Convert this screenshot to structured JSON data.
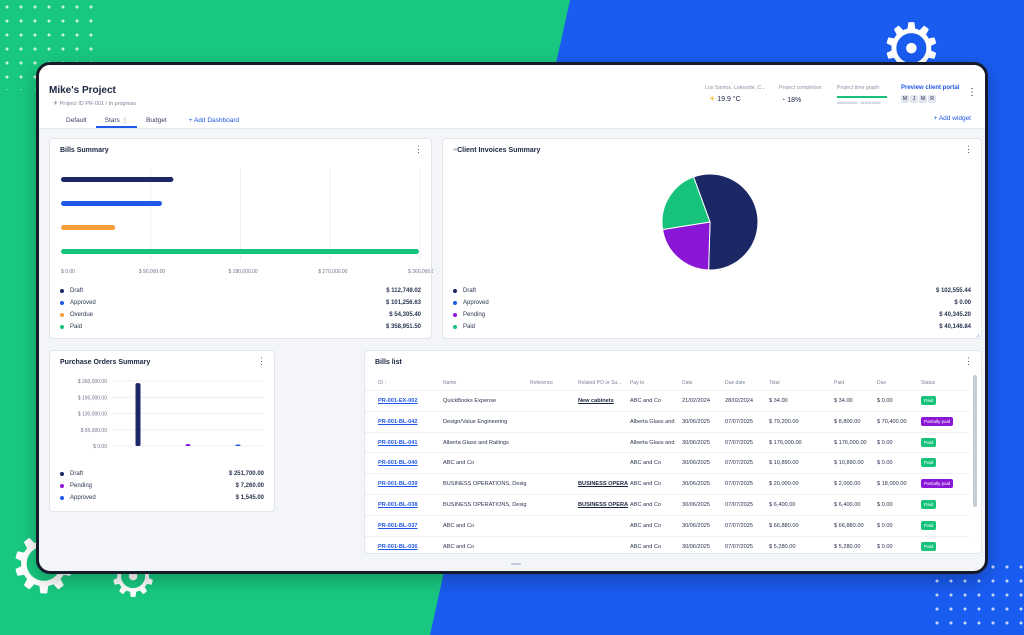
{
  "colors": {
    "navy": "#1c2866",
    "blue": "#1f57e6",
    "orange": "#f59e3a",
    "green": "#17c37b",
    "purple": "#8a17d6",
    "paid": "#17c37b",
    "partial": "#8a17d6"
  },
  "header": {
    "title": "Mike's Project",
    "subtitle": "Project ID PR-001 / In progress",
    "weather_label": "Los Santos, Lakeside, C...",
    "weather_value": "19.9 °C",
    "completion_label": "Project completion",
    "completion_value": "18%",
    "completion_fraction": 0.18,
    "timegraph_label": "Project time graph",
    "timegraph_range": "08/02/2024 - 01/04/2024",
    "preview_label": "Preview client portal",
    "avatars": [
      "M",
      "J",
      "M",
      "R"
    ],
    "tabs": [
      {
        "label": "Default"
      },
      {
        "label": "Stars"
      },
      {
        "label": "Budget"
      }
    ],
    "add_dashboard": "Add Dashboard",
    "add_widget": "Add widget"
  },
  "bills_summary": {
    "title": "Bills Summary",
    "chart_data": {
      "type": "bar",
      "orientation": "horizontal",
      "categories": [
        "Draft",
        "Approved",
        "Overdue",
        "Paid"
      ],
      "values": [
        112749.02,
        101256.63,
        54305.4,
        358951.5
      ],
      "xlim": [
        0,
        360000
      ],
      "xticks": [
        "$ 0.00",
        "$ 90,000.00",
        "$ 180,000.00",
        "$ 270,000.00",
        "$ 360,000.00"
      ]
    },
    "legend": [
      {
        "label": "Draft",
        "value": "$ 112,749.02"
      },
      {
        "label": "Approved",
        "value": "$ 101,256.63"
      },
      {
        "label": "Overdue",
        "value": "$ 54,305.40"
      },
      {
        "label": "Paid",
        "value": "$ 358,951.50"
      }
    ]
  },
  "client_invoices": {
    "title": "Client Invoices Summary",
    "chart_data": {
      "type": "pie",
      "categories": [
        "Draft",
        "Approved",
        "Pending",
        "Paid"
      ],
      "values": [
        102555.44,
        0,
        40345.2,
        40146.84
      ]
    },
    "legend": [
      {
        "label": "Draft",
        "value": "$ 102,555.44"
      },
      {
        "label": "Approved",
        "value": "$ 0.00"
      },
      {
        "label": "Pending",
        "value": "$ 40,345.20"
      },
      {
        "label": "Paid",
        "value": "$ 40,146.84"
      }
    ]
  },
  "purchase_orders": {
    "title": "Purchase Orders Summary",
    "chart_data": {
      "type": "bar",
      "categories": [
        "Draft",
        "Pending",
        "Approved"
      ],
      "values": [
        251700.0,
        7260.0,
        1545.0
      ],
      "ylim": [
        0,
        260000
      ],
      "yticks": [
        "$ 260,000.00",
        "$ 195,000.00",
        "$ 130,000.00",
        "$ 65,000.00",
        "$ 0.00"
      ]
    },
    "legend": [
      {
        "label": "Draft",
        "value": "$ 251,700.00"
      },
      {
        "label": "Pending",
        "value": "$ 7,260.00"
      },
      {
        "label": "Approved",
        "value": "$ 1,545.00"
      }
    ]
  },
  "bills_list": {
    "title": "Bills list",
    "columns": [
      "ID",
      "Name",
      "Reference",
      "Related PO or Su...",
      "Pay to",
      "Date",
      "Due date",
      "Total",
      "Paid",
      "Due",
      "Status"
    ],
    "rows": [
      {
        "id": "PR-001-EX-002",
        "name": "QuickBooks Expense",
        "ref": "",
        "po": "New cabinets",
        "payto": "ABC and Co",
        "date": "21/02/2024",
        "due_date": "28/02/2024",
        "total": "$ 34.00",
        "paid": "$ 34.00",
        "due": "$ 0.00",
        "status": "Paid"
      },
      {
        "id": "PR-001-BL-042",
        "name": "Design/Value Engineering",
        "ref": "",
        "po": "",
        "payto": "Alberta Glass and",
        "date": "30/06/2025",
        "due_date": "07/07/2025",
        "total": "$ 79,200.00",
        "paid": "$ 8,800.00",
        "due": "$ 70,400.00",
        "status": "Partially paid"
      },
      {
        "id": "PR-001-BL-041",
        "name": "Alberta Glass and Railings",
        "ref": "",
        "po": "",
        "payto": "Alberta Glass and",
        "date": "30/06/2025",
        "due_date": "07/07/2025",
        "total": "$ 176,000.00",
        "paid": "$ 176,000.00",
        "due": "$ 0.00",
        "status": "Paid"
      },
      {
        "id": "PR-001-BL-040",
        "name": "ABC and Co",
        "ref": "",
        "po": "",
        "payto": "ABC and Co",
        "date": "30/06/2025",
        "due_date": "07/07/2025",
        "total": "$ 10,890.00",
        "paid": "$ 10,890.00",
        "due": "$ 0.00",
        "status": "Paid"
      },
      {
        "id": "PR-001-BL-039",
        "name": "BUSINESS OPERATIONS, Desig",
        "ref": "",
        "po": "BUSINESS OPERA",
        "payto": "ABC and Co",
        "date": "30/06/2025",
        "due_date": "07/07/2025",
        "total": "$ 20,000.00",
        "paid": "$ 2,000.00",
        "due": "$ 18,000.00",
        "status": "Partially paid"
      },
      {
        "id": "PR-001-BL-038",
        "name": "BUSINESS OPERATIONS, Desig",
        "ref": "",
        "po": "BUSINESS OPERA",
        "payto": "ABC and Co",
        "date": "30/06/2025",
        "due_date": "07/07/2025",
        "total": "$ 6,400.00",
        "paid": "$ 6,400.00",
        "due": "$ 0.00",
        "status": "Paid"
      },
      {
        "id": "PR-001-BL-037",
        "name": "ABC and Co",
        "ref": "",
        "po": "",
        "payto": "ABC and Co",
        "date": "30/06/2025",
        "due_date": "07/07/2025",
        "total": "$ 66,880.00",
        "paid": "$ 66,880.00",
        "due": "$ 0.00",
        "status": "Paid"
      },
      {
        "id": "PR-001-BL-036",
        "name": "ABC and Co",
        "ref": "",
        "po": "",
        "payto": "ABC and Co",
        "date": "30/06/2025",
        "due_date": "07/07/2025",
        "total": "$ 5,280.00",
        "paid": "$ 5,280.00",
        "due": "$ 0.00",
        "status": "Paid"
      }
    ]
  }
}
